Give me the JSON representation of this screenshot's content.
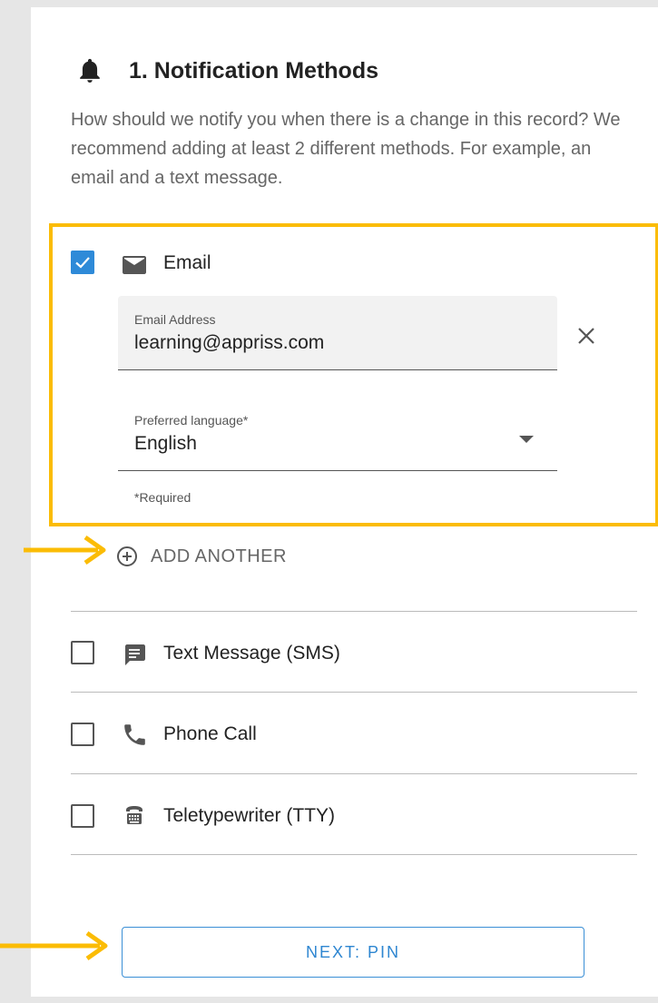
{
  "section": {
    "title": "1. Notification Methods",
    "description": "How should we notify you when there is a change in this record? We recommend adding at least 2 different methods. For example, an email and a text message."
  },
  "email_method": {
    "label": "Email",
    "checked": true,
    "address_field": {
      "label": "Email Address",
      "value": "learning@appriss.com"
    },
    "language_field": {
      "label": "Preferred language*",
      "value": "English"
    },
    "required_note": "*Required"
  },
  "add_another_label": "ADD ANOTHER",
  "methods": [
    {
      "label": "Text Message (SMS)",
      "icon": "message-icon",
      "checked": false
    },
    {
      "label": "Phone Call",
      "icon": "phone-icon",
      "checked": false
    },
    {
      "label": "Teletypewriter (TTY)",
      "icon": "tty-icon",
      "checked": false
    }
  ],
  "next_button_label": "NEXT: PIN",
  "colors": {
    "highlight": "#fbbc05",
    "accent": "#2e8ad8",
    "arrow": "#fbbc05"
  }
}
